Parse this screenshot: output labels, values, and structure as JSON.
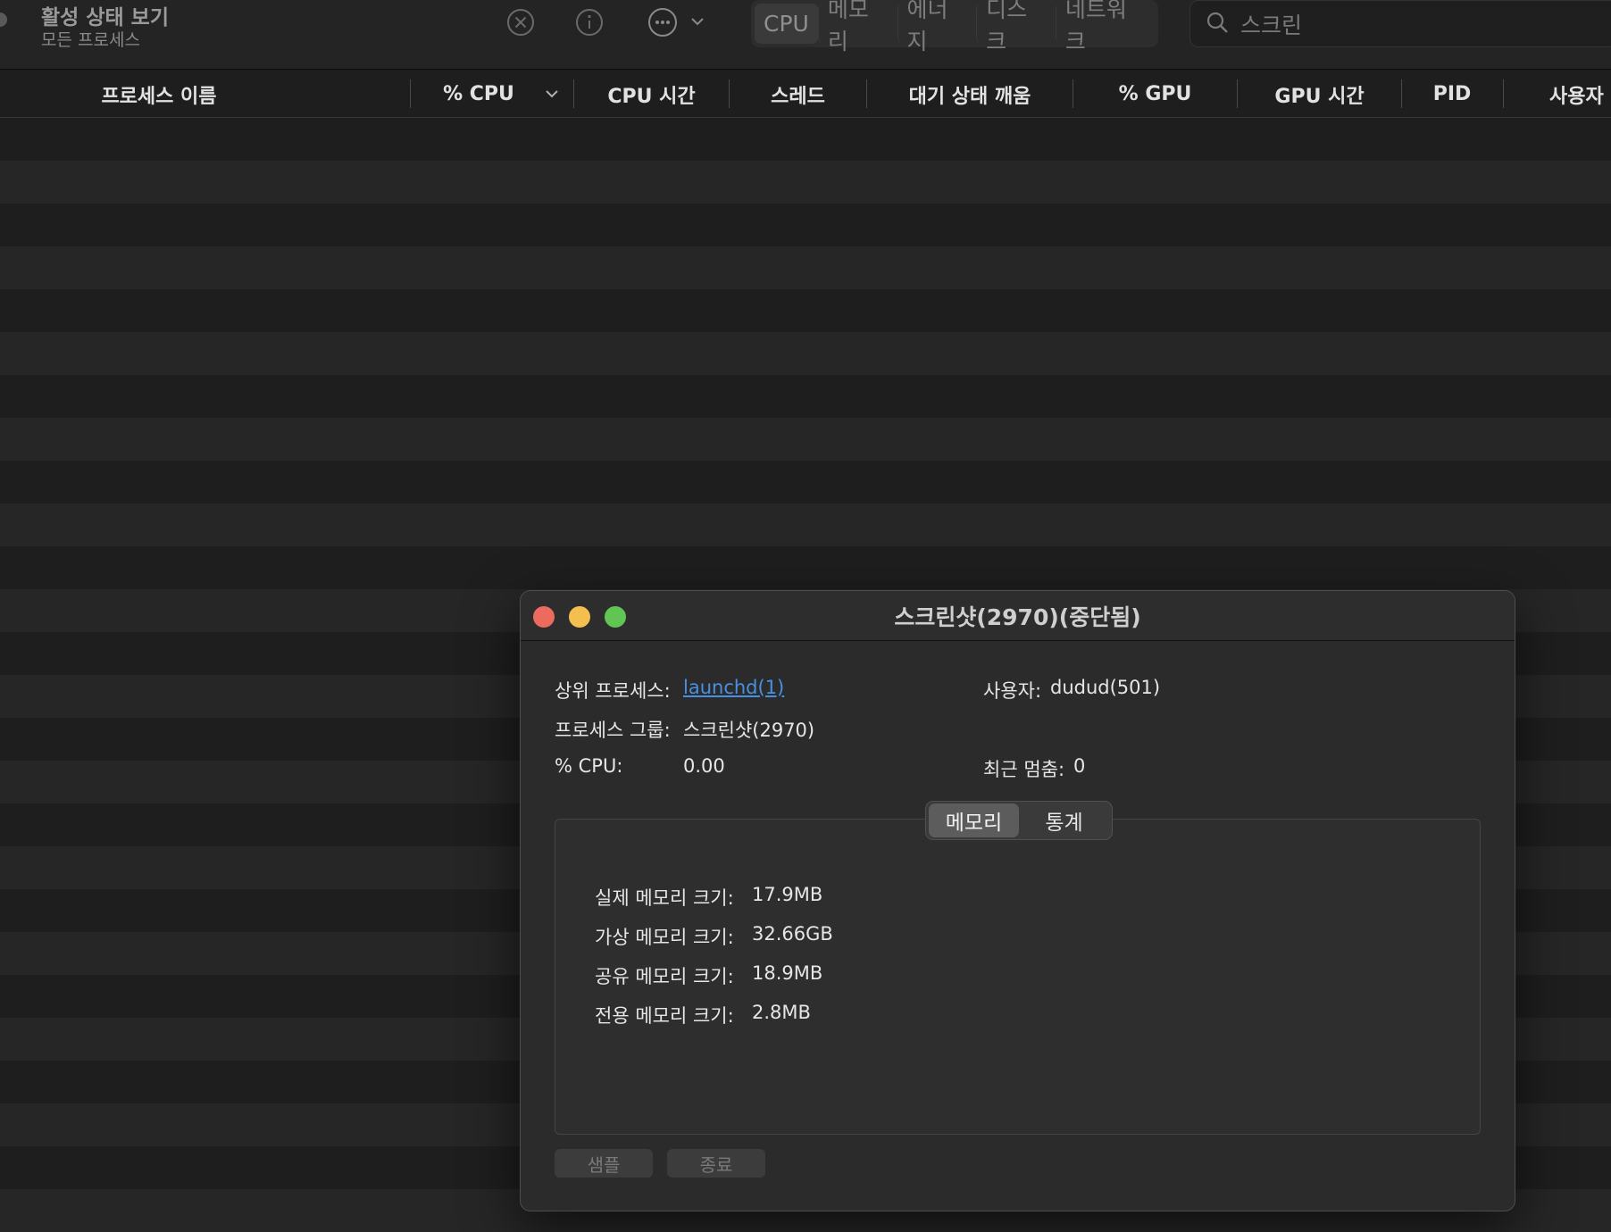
{
  "app": {
    "title": "활성 상태 보기",
    "subtitle": "모든 프로세스"
  },
  "toolbar": {
    "icons": [
      "stop-process-icon",
      "info-icon",
      "more-actions-icon"
    ],
    "tabs": [
      {
        "label": "CPU",
        "active": true
      },
      {
        "label": "메모리",
        "active": false
      },
      {
        "label": "에너지",
        "active": false
      },
      {
        "label": "디스크",
        "active": false
      },
      {
        "label": "네트워크",
        "active": false
      }
    ],
    "search": {
      "value": "스크린"
    }
  },
  "columns": [
    "프로세스 이름",
    "% CPU",
    "CPU 시간",
    "스레드",
    "대기 상태 깨움",
    "% GPU",
    "GPU 시간",
    "PID",
    "사용자"
  ],
  "inspector": {
    "title": "스크린샷(2970)(중단됨)",
    "parent_label": "상위 프로세스:",
    "parent_value": "launchd(1)",
    "user_label": "사용자:",
    "user_value": "dudud(501)",
    "group_label": "프로세스 그룹:",
    "group_value": "스크린샷(2970)",
    "cpu_label": "% CPU:",
    "cpu_value": "0.00",
    "hangs_label": "최근 멈춤:",
    "hangs_value": "0",
    "tabs": [
      {
        "label": "메모리",
        "active": true
      },
      {
        "label": "통계",
        "active": false
      }
    ],
    "memory": [
      {
        "label": "실제 메모리 크기:",
        "value": "17.9MB"
      },
      {
        "label": "가상 메모리 크기:",
        "value": "32.66GB"
      },
      {
        "label": "공유 메모리 크기:",
        "value": "18.9MB"
      },
      {
        "label": "전용 메모리 크기:",
        "value": "2.8MB"
      }
    ],
    "buttons": {
      "sample": "샘플",
      "quit": "종료"
    }
  },
  "colors": {
    "close": "#ed6a5e",
    "minimize": "#f4bf4f",
    "maximize": "#61c554",
    "link": "#4a90e2"
  }
}
